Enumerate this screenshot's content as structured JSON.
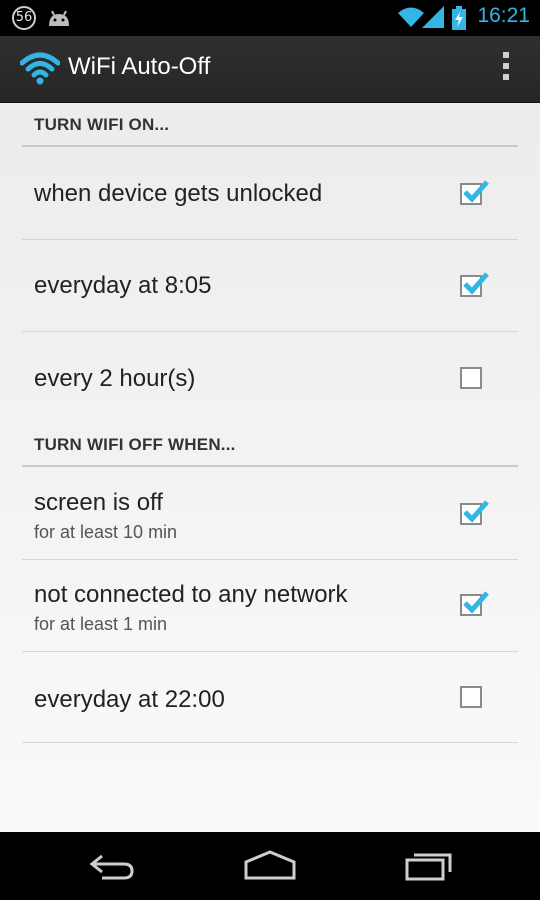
{
  "status_bar": {
    "notification_count": "56",
    "time": "16:21"
  },
  "action_bar": {
    "title": "WiFi Auto-Off",
    "app_icon": "wifi-icon",
    "overflow_icon": "overflow-menu-icon"
  },
  "sections": [
    {
      "header": "TURN WIFI ON...",
      "items": [
        {
          "title": "when device gets unlocked",
          "summary": "",
          "checked": true
        },
        {
          "title": "everyday at 8:05",
          "summary": "",
          "checked": true
        },
        {
          "title": "every 2 hour(s)",
          "summary": "",
          "checked": false
        }
      ]
    },
    {
      "header": "TURN WIFI OFF WHEN...",
      "items": [
        {
          "title": "screen is off",
          "summary": "for at least 10 min",
          "checked": true
        },
        {
          "title": "not connected to any network",
          "summary": "for at least 1 min",
          "checked": true
        },
        {
          "title": "everyday at 22:00",
          "summary": "",
          "checked": false
        }
      ]
    }
  ],
  "colors": {
    "accent": "#33b5e5",
    "action_bar": "#2b2b2b",
    "check": "#33b5e5"
  },
  "nav_bar": {
    "icons": [
      "back-icon",
      "home-icon",
      "recent-apps-icon"
    ]
  }
}
